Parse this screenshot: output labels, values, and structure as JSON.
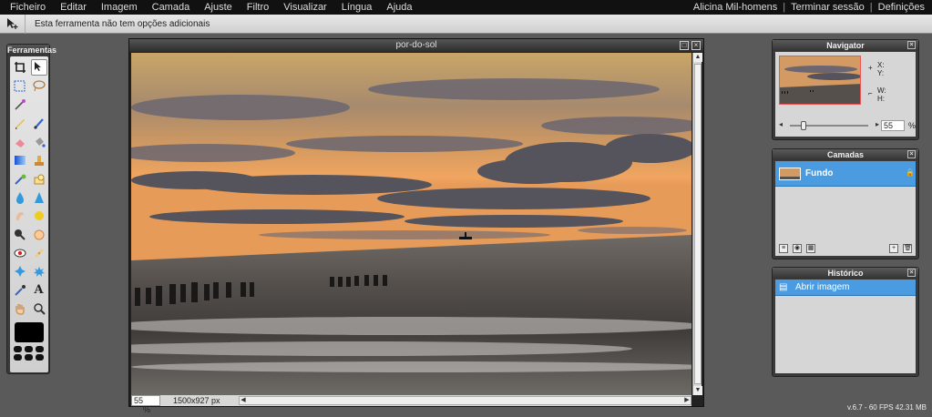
{
  "menu": {
    "items": [
      "Ficheiro",
      "Editar",
      "Imagem",
      "Camada",
      "Ajuste",
      "Filtro",
      "Visualizar",
      "Língua",
      "Ajuda"
    ],
    "user": "Alicina Mil-homens",
    "logout": "Terminar sessão",
    "settings": "Definições",
    "separator": "|"
  },
  "options": {
    "text": "Esta ferramenta não tem opções adicionais"
  },
  "toolbox": {
    "title": "Ferramentas"
  },
  "image_window": {
    "title": "por-do-sol",
    "zoom": "55",
    "zoom_unit": "%",
    "dimensions": "1500x927 px"
  },
  "navigator": {
    "title": "Navigator",
    "x_label": "X:",
    "y_label": "Y:",
    "w_label": "W:",
    "h_label": "H:",
    "zoom": "55",
    "zoom_unit": "%"
  },
  "layers": {
    "title": "Camadas",
    "items": [
      {
        "name": "Fundo"
      }
    ]
  },
  "history": {
    "title": "Histórico",
    "items": [
      {
        "label": "Abrir imagem"
      }
    ]
  },
  "status": {
    "text": "v.6.7 - 60 FPS 42.31 MB"
  }
}
